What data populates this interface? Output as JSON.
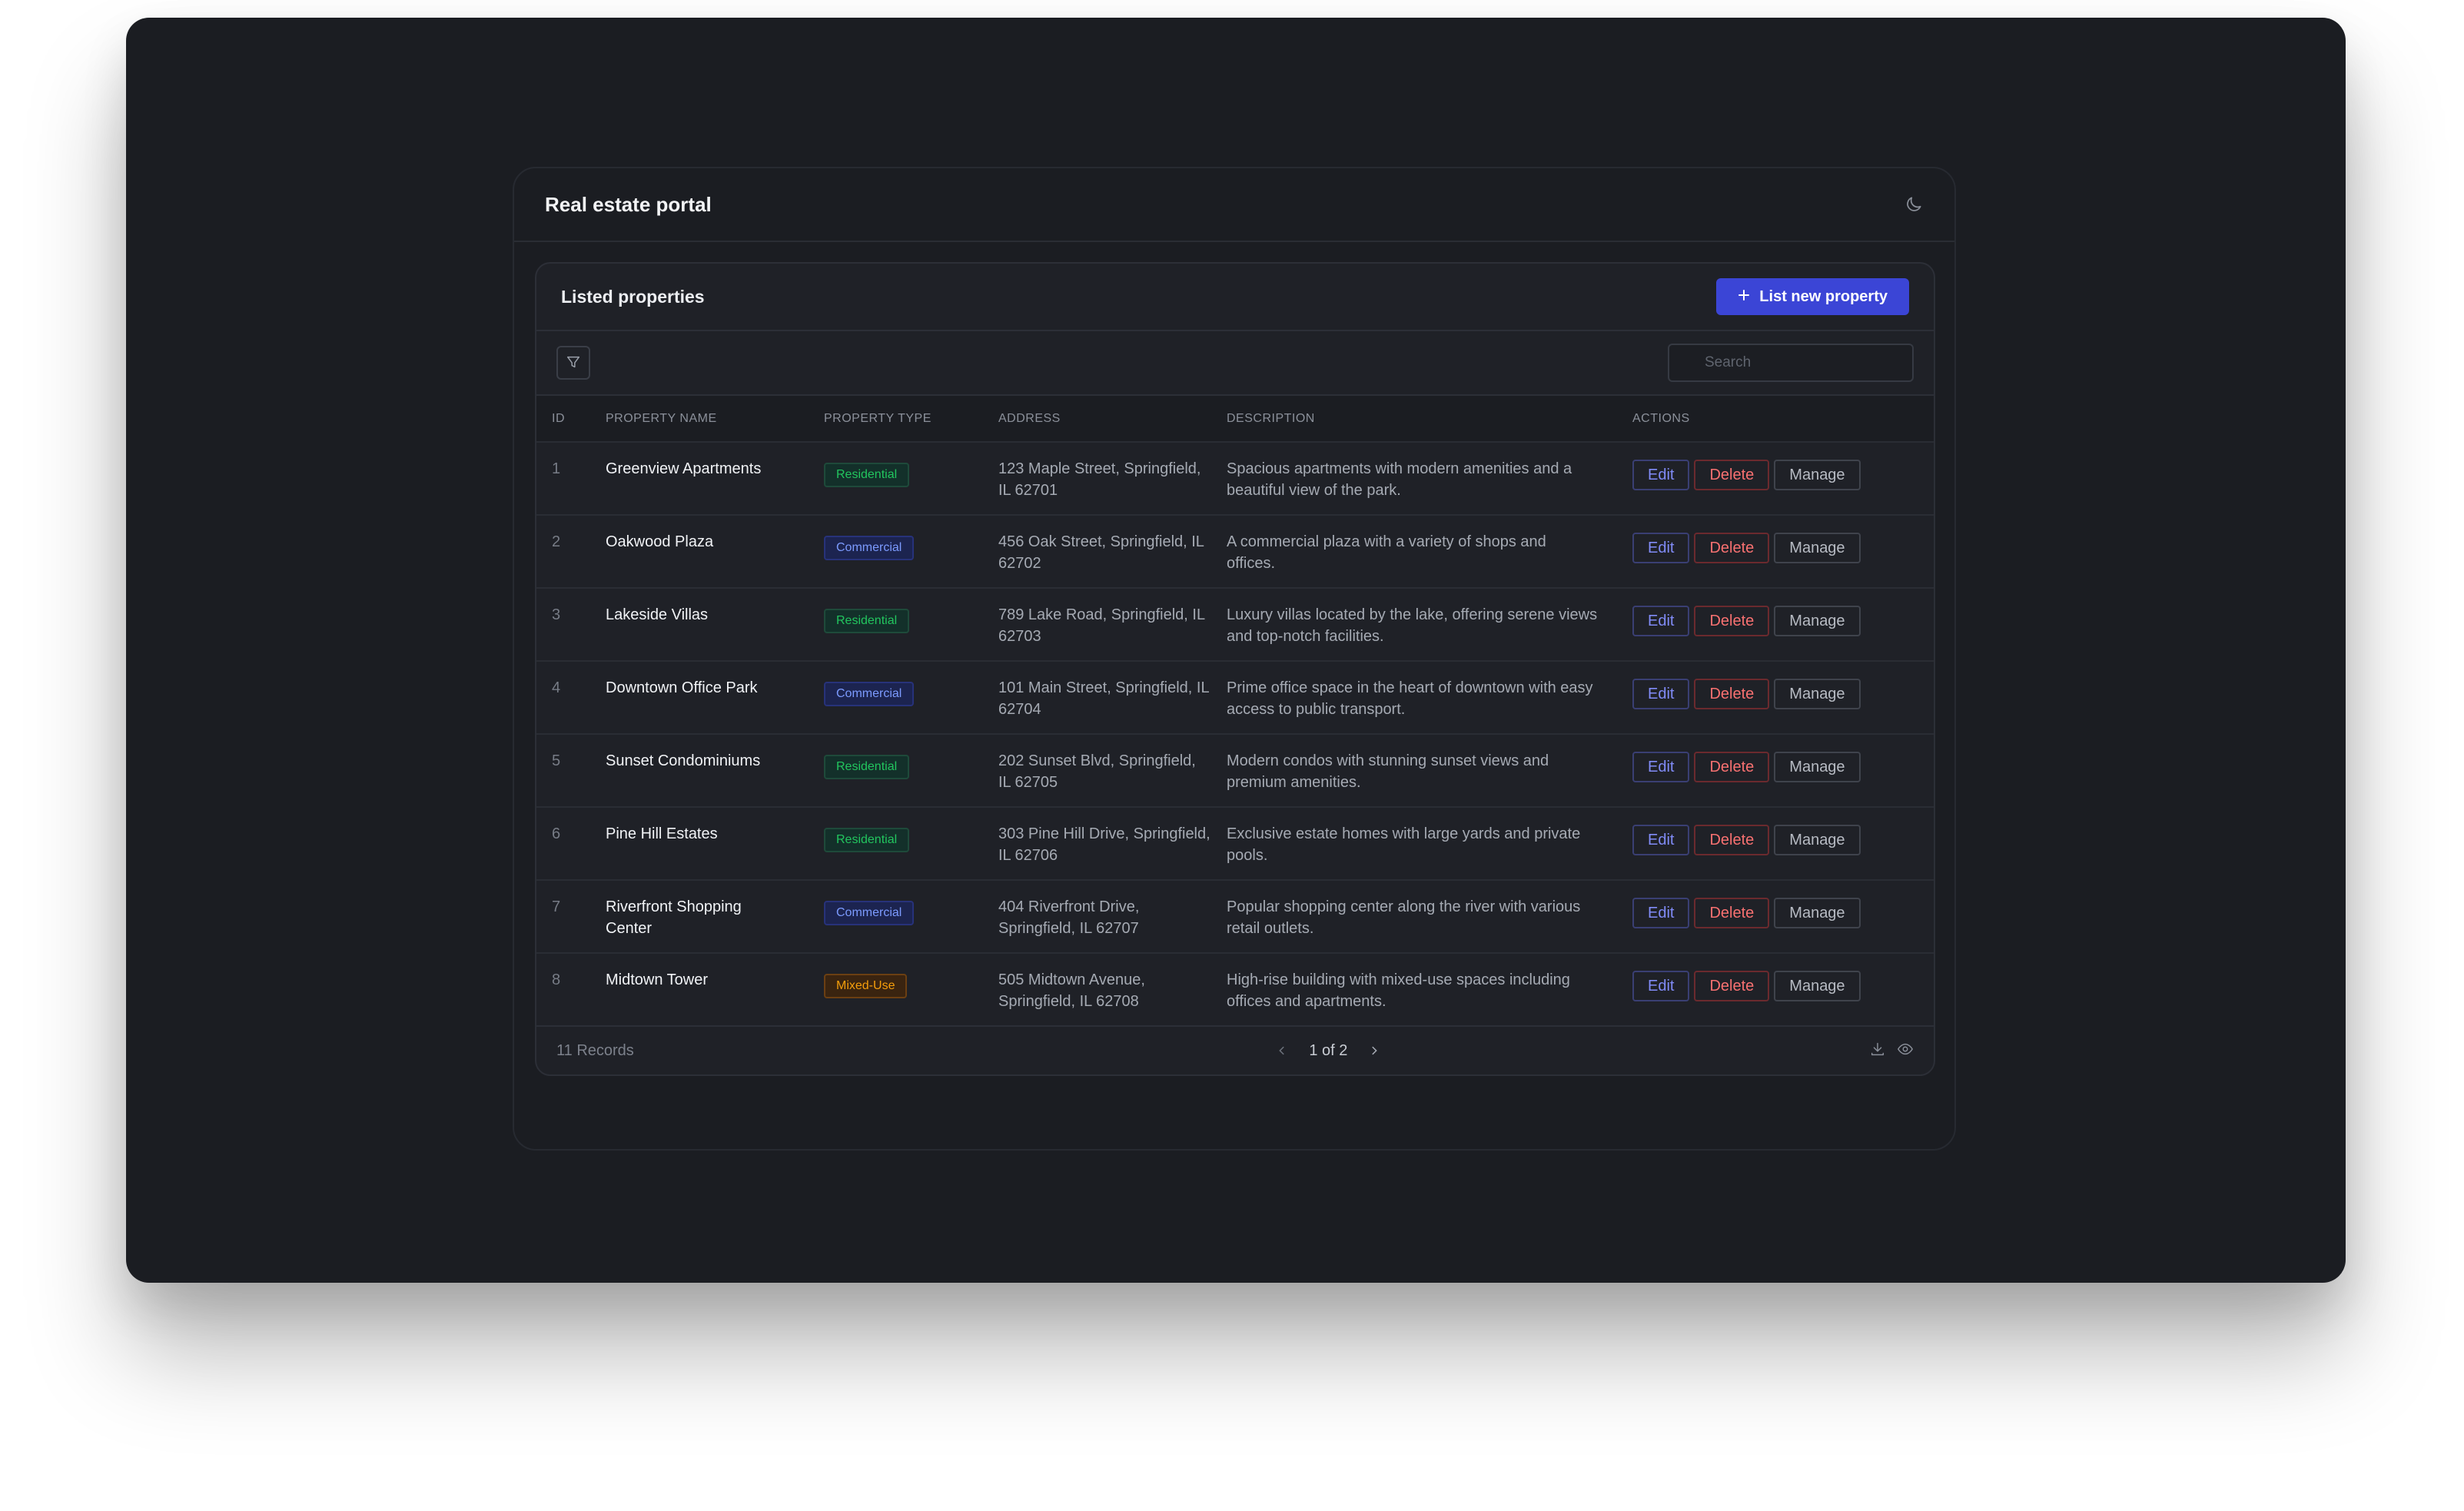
{
  "app": {
    "title": "Real estate portal",
    "theme_icon": "moon-icon"
  },
  "card": {
    "title": "Listed properties",
    "primary_button": {
      "icon": "plus-icon",
      "label": "List new property"
    }
  },
  "toolbar": {
    "filter_icon": "filter-icon",
    "search_placeholder": "Search"
  },
  "table": {
    "columns": [
      "ID",
      "PROPERTY NAME",
      "PROPERTY TYPE",
      "ADDRESS",
      "DESCRIPTION",
      "ACTIONS"
    ],
    "action_labels": {
      "edit": "Edit",
      "delete": "Delete",
      "manage": "Manage"
    },
    "rows": [
      {
        "id": "1",
        "name": "Greenview Apartments",
        "type": "Residential",
        "type_key": "residential",
        "address": "123 Maple Street, Springfield, IL 62701",
        "description": "Spacious apartments with modern amenities and a beautiful view of the park."
      },
      {
        "id": "2",
        "name": "Oakwood Plaza",
        "type": "Commercial",
        "type_key": "commercial",
        "address": "456 Oak Street, Springfield, IL 62702",
        "description": "A commercial plaza with a variety of shops and offices."
      },
      {
        "id": "3",
        "name": "Lakeside Villas",
        "type": "Residential",
        "type_key": "residential",
        "address": "789 Lake Road, Springfield, IL 62703",
        "description": "Luxury villas located by the lake, offering serene views and top-notch facilities."
      },
      {
        "id": "4",
        "name": "Downtown Office Park",
        "type": "Commercial",
        "type_key": "commercial",
        "address": "101 Main Street, Springfield, IL 62704",
        "description": "Prime office space in the heart of downtown with easy access to public transport."
      },
      {
        "id": "5",
        "name": "Sunset Condominiums",
        "type": "Residential",
        "type_key": "residential",
        "address": "202 Sunset Blvd, Springfield, IL 62705",
        "description": "Modern condos with stunning sunset views and premium amenities."
      },
      {
        "id": "6",
        "name": "Pine Hill Estates",
        "type": "Residential",
        "type_key": "residential",
        "address": "303 Pine Hill Drive, Springfield, IL 62706",
        "description": "Exclusive estate homes with large yards and private pools."
      },
      {
        "id": "7",
        "name": "Riverfront Shopping Center",
        "type": "Commercial",
        "type_key": "commercial",
        "address": "404 Riverfront Drive, Springfield, IL 62707",
        "description": "Popular shopping center along the river with various retail outlets."
      },
      {
        "id": "8",
        "name": "Midtown Tower",
        "type": "Mixed-Use",
        "type_key": "mixed",
        "address": "505 Midtown Avenue, Springfield, IL 62708",
        "description": "High-rise building with mixed-use spaces including offices and apartments."
      }
    ]
  },
  "footer": {
    "records": "11 Records",
    "page": "1 of 2",
    "prev_icon": "chevron-left-icon",
    "next_icon": "chevron-right-icon",
    "download_icon": "download-icon",
    "view_icon": "eye-icon"
  },
  "colors": {
    "accent": "#3b45d6",
    "residential": "#22c55e",
    "commercial": "#7c9bff",
    "mixed_use": "#f59e0b",
    "delete": "#f87171"
  }
}
